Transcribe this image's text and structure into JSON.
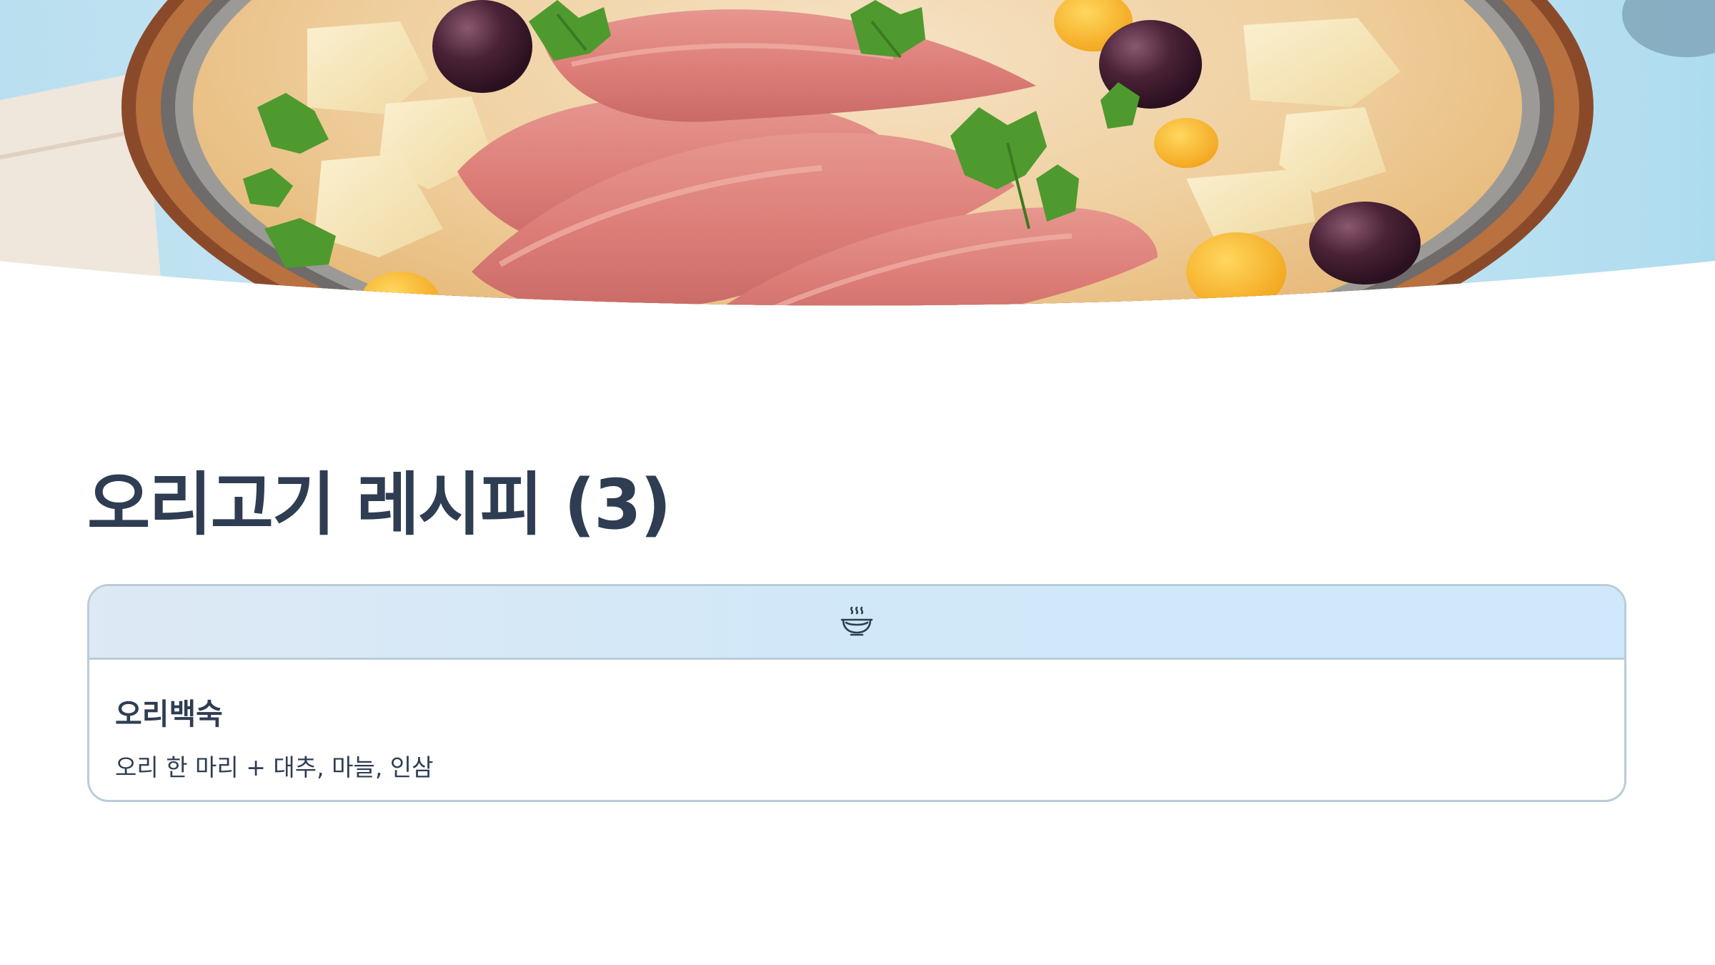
{
  "hero": {
    "image": "duck-soup-photo",
    "subject": "bowl of duck meat soup with potatoes, dates and parsley"
  },
  "title": "오리고기 레시피 (3)",
  "card": {
    "icon": "soup-bowl-icon",
    "title": "오리백숙",
    "description": "오리 한 마리 + 대추, 마늘, 인삼"
  },
  "colors": {
    "text": "#2e3d52",
    "card_border": "#b9ccd9",
    "card_header_bg": "#d1e8f8"
  }
}
